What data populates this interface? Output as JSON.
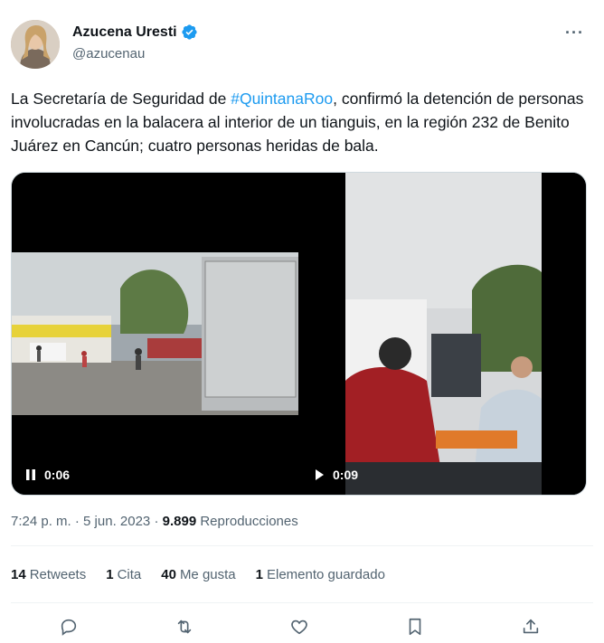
{
  "author": {
    "display_name": "Azucena Uresti",
    "handle": "@azucenau",
    "verified": true,
    "verified_color": "#1d9bf0"
  },
  "tweet": {
    "text_before": "La Secretaría de Seguridad de ",
    "hashtag": "#QuintanaRoo",
    "text_after": ", confirmó la detención de personas involucradas en la balacera al interior de un tianguis, en la región 232 de Benito Juárez en Cancún; cuatro personas heridas de bala.",
    "link_color": "#1d9bf0"
  },
  "media": {
    "videos": [
      {
        "state_icon": "pause-icon",
        "time": "0:06"
      },
      {
        "state_icon": "play-icon",
        "time": "0:09"
      }
    ]
  },
  "meta": {
    "time": "7:24 p. m.",
    "separator": "·",
    "date": "5 jun. 2023",
    "views_count": "9.899",
    "views_label": "Reproducciones"
  },
  "stats": {
    "retweets_count": "14",
    "retweets_label": "Retweets",
    "quotes_count": "1",
    "quotes_label": "Cita",
    "likes_count": "40",
    "likes_label": "Me gusta",
    "bookmarks_count": "1",
    "bookmarks_label": "Elemento guardado"
  },
  "actions": [
    "reply-icon",
    "retweet-icon",
    "like-icon",
    "bookmark-icon",
    "share-icon"
  ]
}
